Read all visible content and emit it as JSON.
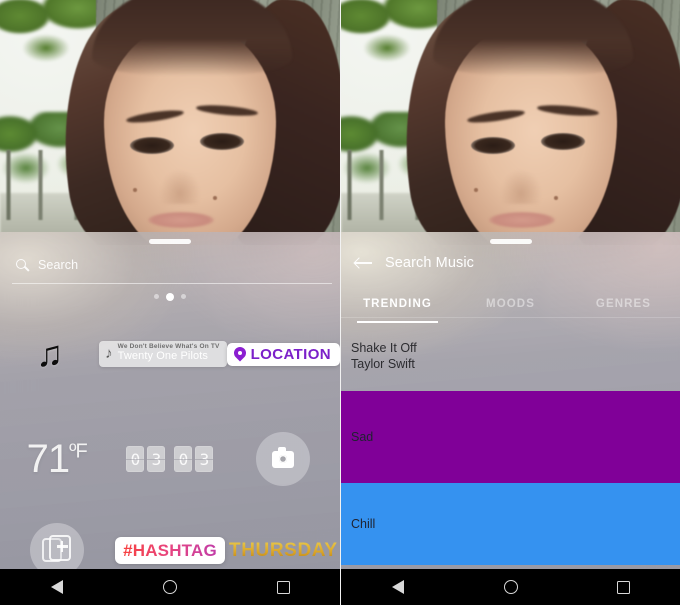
{
  "app": {
    "platform": "Android",
    "screen_count": 2
  },
  "left_panel": {
    "name": "sticker-tray",
    "search": {
      "placeholder": "Search",
      "icon": "search-icon"
    },
    "pager": {
      "count": 3,
      "active_index": 1
    },
    "grabber": "drag-handle",
    "stickers": {
      "music_note": {
        "label": "♫",
        "icon": "music-note-icon"
      },
      "music_track": {
        "title": "We Don't Believe What's On TV",
        "artist": "Twenty One Pilots",
        "icon": "music-note-icon"
      },
      "location": {
        "label": "LOCATION",
        "icon": "location-pin-icon",
        "color": "#7b20c9"
      },
      "temperature": {
        "value": "71",
        "unit": "ºF"
      },
      "clock": {
        "digits": [
          "0",
          "3",
          "0",
          "3"
        ]
      },
      "camera": {
        "icon": "camera-icon"
      },
      "add_photo": {
        "icon": "add-photo-icon"
      },
      "hashtag": {
        "label": "#HASHTAG"
      },
      "weekday": {
        "label": "THURSDAY"
      }
    }
  },
  "right_panel": {
    "name": "search-music",
    "grabber": "drag-handle",
    "header": {
      "title": "Search Music",
      "back_icon": "back-arrow-icon"
    },
    "tabs": [
      {
        "label": "TRENDING",
        "active": true
      },
      {
        "label": "MOODS",
        "active": false
      },
      {
        "label": "GENRES",
        "active": false
      }
    ],
    "song": {
      "title": "Shake It Off",
      "artist": "Taylor Swift"
    },
    "mood_bands": [
      {
        "label": "Sad",
        "color": "#800098"
      },
      {
        "label": "Chill",
        "color": "#3592f0"
      }
    ]
  },
  "nav_bar": {
    "back": "back-triangle-icon",
    "home": "home-circle-icon",
    "recents": "recents-square-icon"
  }
}
